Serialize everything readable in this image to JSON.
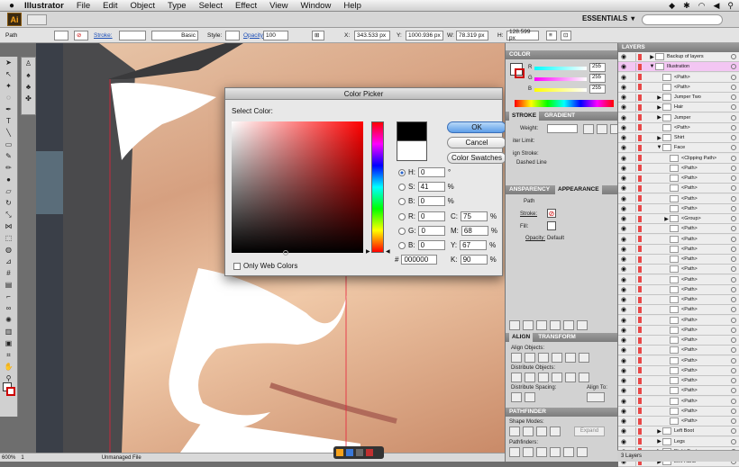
{
  "menubar": {
    "app": "Illustrator",
    "items": [
      "File",
      "Edit",
      "Object",
      "Type",
      "Select",
      "Effect",
      "View",
      "Window",
      "Help"
    ]
  },
  "appbar": {
    "logo": "Ai",
    "workspace": "ESSENTIALS"
  },
  "controlbar": {
    "selection": "Path",
    "stroke_label": "Stroke:",
    "brush": "Basic",
    "style_label": "Style:",
    "opacity_label": "Opacity:",
    "opacity": "100",
    "x_label": "X:",
    "x": "343.533 px",
    "y_label": "Y:",
    "y": "1000.936 px",
    "w_label": "W:",
    "w": "78.319 px",
    "h_label": "H:",
    "h": "128.599 px"
  },
  "status": {
    "zoom": "600%",
    "page": "1",
    "info": "Unmanaged File"
  },
  "color_picker": {
    "title": "Color Picker",
    "select_label": "Select Color:",
    "ok": "OK",
    "cancel": "Cancel",
    "swatches": "Color Swatches",
    "only_web": "Only Web Colors",
    "fields": {
      "H": "0",
      "S": "41",
      "B": "0",
      "R": "0",
      "G": "0",
      "Bl": "0",
      "C": "75",
      "M": "68",
      "Y": "67",
      "K": "90",
      "hex": "000000"
    },
    "units": {
      "deg": "°",
      "pct": "%",
      "hash": "#"
    },
    "colors": {
      "new": "#000000",
      "old": "#ffffff"
    }
  },
  "color_panel": {
    "title": "COLOR",
    "r_label": "R",
    "r_val": "255",
    "g_label": "G",
    "g_val": "255",
    "b_label": "B",
    "b_val": "255"
  },
  "stroke_panel": {
    "tabs": [
      "STROKE",
      "GRADIENT"
    ],
    "weight": "Weight:",
    "miter": "iter Limit:",
    "align": "ign Stroke:",
    "dashed": "Dashed Line"
  },
  "appearance_panel": {
    "tabs": [
      "ANSPARENCY",
      "APPEARANCE"
    ],
    "path": "Path",
    "stroke": "Stroke:",
    "fill": "Fill:",
    "opacity": "Opacity:",
    "opacity_val": "Default"
  },
  "align_panel": {
    "tabs": [
      "ALIGN",
      "TRANSFORM"
    ],
    "align_objects": "Align Objects:",
    "distribute_objects": "Distribute Objects:",
    "distribute_spacing": "Distribute Spacing:",
    "align_to": "Align To:"
  },
  "pathfinder_panel": {
    "title": "PATHFINDER",
    "shape_modes": "Shape Modes:",
    "expand": "Expand",
    "pathfinders": "Pathfinders:"
  },
  "layers": {
    "title": "LAYERS",
    "footer": "3 Layers",
    "rows": [
      {
        "name": "Backup of layers",
        "indent": 0,
        "sel": false,
        "tri": "▶"
      },
      {
        "name": "Illustration",
        "indent": 0,
        "sel": true,
        "tri": "▼"
      },
      {
        "name": "<Path>",
        "indent": 1,
        "sel": false,
        "tri": ""
      },
      {
        "name": "<Path>",
        "indent": 1,
        "sel": false,
        "tri": ""
      },
      {
        "name": "Jumper Two",
        "indent": 1,
        "sel": false,
        "tri": "▶"
      },
      {
        "name": "Hair",
        "indent": 1,
        "sel": false,
        "tri": "▶"
      },
      {
        "name": "Jumper",
        "indent": 1,
        "sel": false,
        "tri": "▶"
      },
      {
        "name": "<Path>",
        "indent": 1,
        "sel": false,
        "tri": ""
      },
      {
        "name": "Shirt",
        "indent": 1,
        "sel": false,
        "tri": "▶"
      },
      {
        "name": "Face",
        "indent": 1,
        "sel": false,
        "tri": "▼"
      },
      {
        "name": "<Clipping Path>",
        "indent": 2,
        "sel": false,
        "tri": ""
      },
      {
        "name": "<Path>",
        "indent": 2,
        "sel": false,
        "tri": ""
      },
      {
        "name": "<Path>",
        "indent": 2,
        "sel": false,
        "tri": ""
      },
      {
        "name": "<Path>",
        "indent": 2,
        "sel": false,
        "tri": ""
      },
      {
        "name": "<Path>",
        "indent": 2,
        "sel": false,
        "tri": ""
      },
      {
        "name": "<Path>",
        "indent": 2,
        "sel": false,
        "tri": ""
      },
      {
        "name": "<Group>",
        "indent": 2,
        "sel": false,
        "tri": "▶"
      },
      {
        "name": "<Path>",
        "indent": 2,
        "sel": false,
        "tri": ""
      },
      {
        "name": "<Path>",
        "indent": 2,
        "sel": false,
        "tri": ""
      },
      {
        "name": "<Path>",
        "indent": 2,
        "sel": false,
        "tri": ""
      },
      {
        "name": "<Path>",
        "indent": 2,
        "sel": false,
        "tri": ""
      },
      {
        "name": "<Path>",
        "indent": 2,
        "sel": false,
        "tri": ""
      },
      {
        "name": "<Path>",
        "indent": 2,
        "sel": false,
        "tri": ""
      },
      {
        "name": "<Path>",
        "indent": 2,
        "sel": false,
        "tri": ""
      },
      {
        "name": "<Path>",
        "indent": 2,
        "sel": false,
        "tri": ""
      },
      {
        "name": "<Path>",
        "indent": 2,
        "sel": false,
        "tri": ""
      },
      {
        "name": "<Path>",
        "indent": 2,
        "sel": false,
        "tri": ""
      },
      {
        "name": "<Path>",
        "indent": 2,
        "sel": false,
        "tri": ""
      },
      {
        "name": "<Path>",
        "indent": 2,
        "sel": false,
        "tri": ""
      },
      {
        "name": "<Path>",
        "indent": 2,
        "sel": false,
        "tri": ""
      },
      {
        "name": "<Path>",
        "indent": 2,
        "sel": false,
        "tri": ""
      },
      {
        "name": "<Path>",
        "indent": 2,
        "sel": false,
        "tri": ""
      },
      {
        "name": "<Path>",
        "indent": 2,
        "sel": false,
        "tri": ""
      },
      {
        "name": "<Path>",
        "indent": 2,
        "sel": false,
        "tri": ""
      },
      {
        "name": "<Path>",
        "indent": 2,
        "sel": false,
        "tri": ""
      },
      {
        "name": "<Path>",
        "indent": 2,
        "sel": false,
        "tri": ""
      },
      {
        "name": "<Path>",
        "indent": 2,
        "sel": false,
        "tri": ""
      },
      {
        "name": "Left Boot",
        "indent": 1,
        "sel": false,
        "tri": "▶"
      },
      {
        "name": "Legs",
        "indent": 1,
        "sel": false,
        "tri": "▶"
      },
      {
        "name": "Right Boot",
        "indent": 1,
        "sel": false,
        "tri": "▶"
      },
      {
        "name": "Left Hand",
        "indent": 1,
        "sel": false,
        "tri": "▶"
      }
    ]
  }
}
